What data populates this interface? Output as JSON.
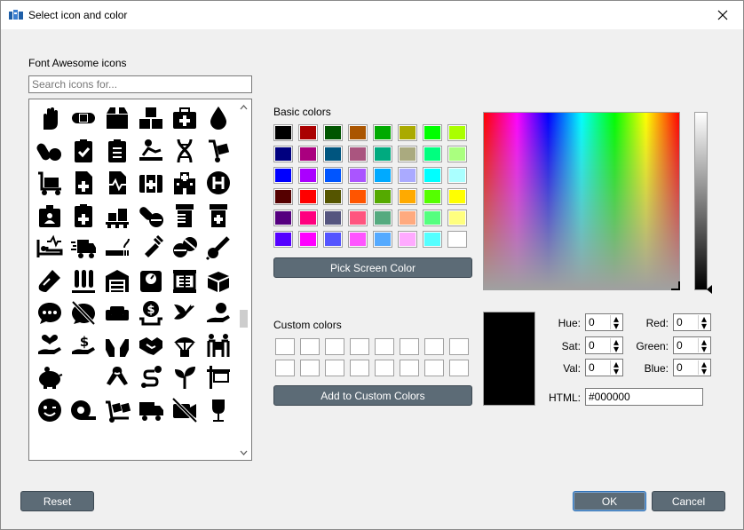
{
  "window": {
    "title": "Select icon and color"
  },
  "icons_panel": {
    "heading": "Font Awesome icons",
    "search_placeholder": "Search icons for..."
  },
  "basic_colors": {
    "heading": "Basic colors",
    "swatches": [
      "#000000",
      "#aa0000",
      "#005500",
      "#aa5500",
      "#00aa00",
      "#aaaa00",
      "#00ff00",
      "#aaff00",
      "#00007f",
      "#aa007f",
      "#00557f",
      "#aa557f",
      "#00aa7f",
      "#aaaa7f",
      "#00ff7f",
      "#aaff7f",
      "#0000ff",
      "#aa00ff",
      "#0055ff",
      "#aa55ff",
      "#00aaff",
      "#aaaaff",
      "#00ffff",
      "#aaffff",
      "#550000",
      "#ff0000",
      "#555500",
      "#ff5500",
      "#55aa00",
      "#ffaa00",
      "#55ff00",
      "#ffff00",
      "#55007f",
      "#ff007f",
      "#55557f",
      "#ff557f",
      "#55aa7f",
      "#ffaa7f",
      "#55ff7f",
      "#ffff7f",
      "#5500ff",
      "#ff00ff",
      "#5555ff",
      "#ff55ff",
      "#55aaff",
      "#ffaaff",
      "#55ffff",
      "#ffffff"
    ]
  },
  "pick_screen_color_label": "Pick Screen Color",
  "custom_colors": {
    "heading": "Custom colors"
  },
  "add_custom_label": "Add to Custom Colors",
  "fields": {
    "hue": {
      "label": "Hue:",
      "value": "0"
    },
    "sat": {
      "label": "Sat:",
      "value": "0"
    },
    "val": {
      "label": "Val:",
      "value": "0"
    },
    "red": {
      "label": "Red:",
      "value": "0"
    },
    "green": {
      "label": "Green:",
      "value": "0"
    },
    "blue": {
      "label": "Blue:",
      "value": "0"
    },
    "html": {
      "label": "HTML:",
      "value": "#000000"
    }
  },
  "current_color": "#000000",
  "buttons": {
    "reset": "Reset",
    "ok": "OK",
    "cancel": "Cancel"
  },
  "accent_color": "#5c6b76",
  "icon_names": [
    "hand-sparkles-icon",
    "band-aid-icon",
    "box-icon",
    "boxes-icon",
    "first-aid-icon",
    "tint-icon",
    "capsules-icon",
    "clipboard-check-icon",
    "clipboard-list-icon",
    "diagnoses-icon",
    "dna-icon",
    "dolly-icon",
    "dolly-flatbed-icon",
    "file-medical-icon",
    "file-medical-alt-icon",
    "first-aid-kit-icon",
    "hospital-icon",
    "hospital-symbol-icon",
    "id-card-alt-icon",
    "notes-medical-icon",
    "pallet-icon",
    "pills-icon",
    "prescription-bottle-icon",
    "prescription-bottle-alt-icon",
    "procedures-icon",
    "shipping-fast-icon",
    "smoking-icon",
    "syringe-icon",
    "tablets-icon",
    "thermometer-icon",
    "vial-icon",
    "vials-icon",
    "warehouse-icon",
    "weight-icon",
    "x-ray-icon",
    "box-open-icon",
    "comment-dots-icon",
    "comment-slash-icon",
    "couch-icon",
    "donate-icon",
    "dove-icon",
    "hand-holding-icon",
    "hand-holding-heart-icon",
    "hand-holding-usd-icon",
    "hands-icon",
    "handshake-icon",
    "parachute-box-icon",
    "people-carry-icon",
    "piggy-bank-icon",
    "blank-icon",
    "ribbon-icon",
    "route-icon",
    "seedling-icon",
    "sign-icon",
    "smile-wink-icon",
    "tape-icon",
    "truck-loading-icon",
    "truck-moving-icon",
    "video-slash-icon",
    "wine-glass-icon"
  ]
}
